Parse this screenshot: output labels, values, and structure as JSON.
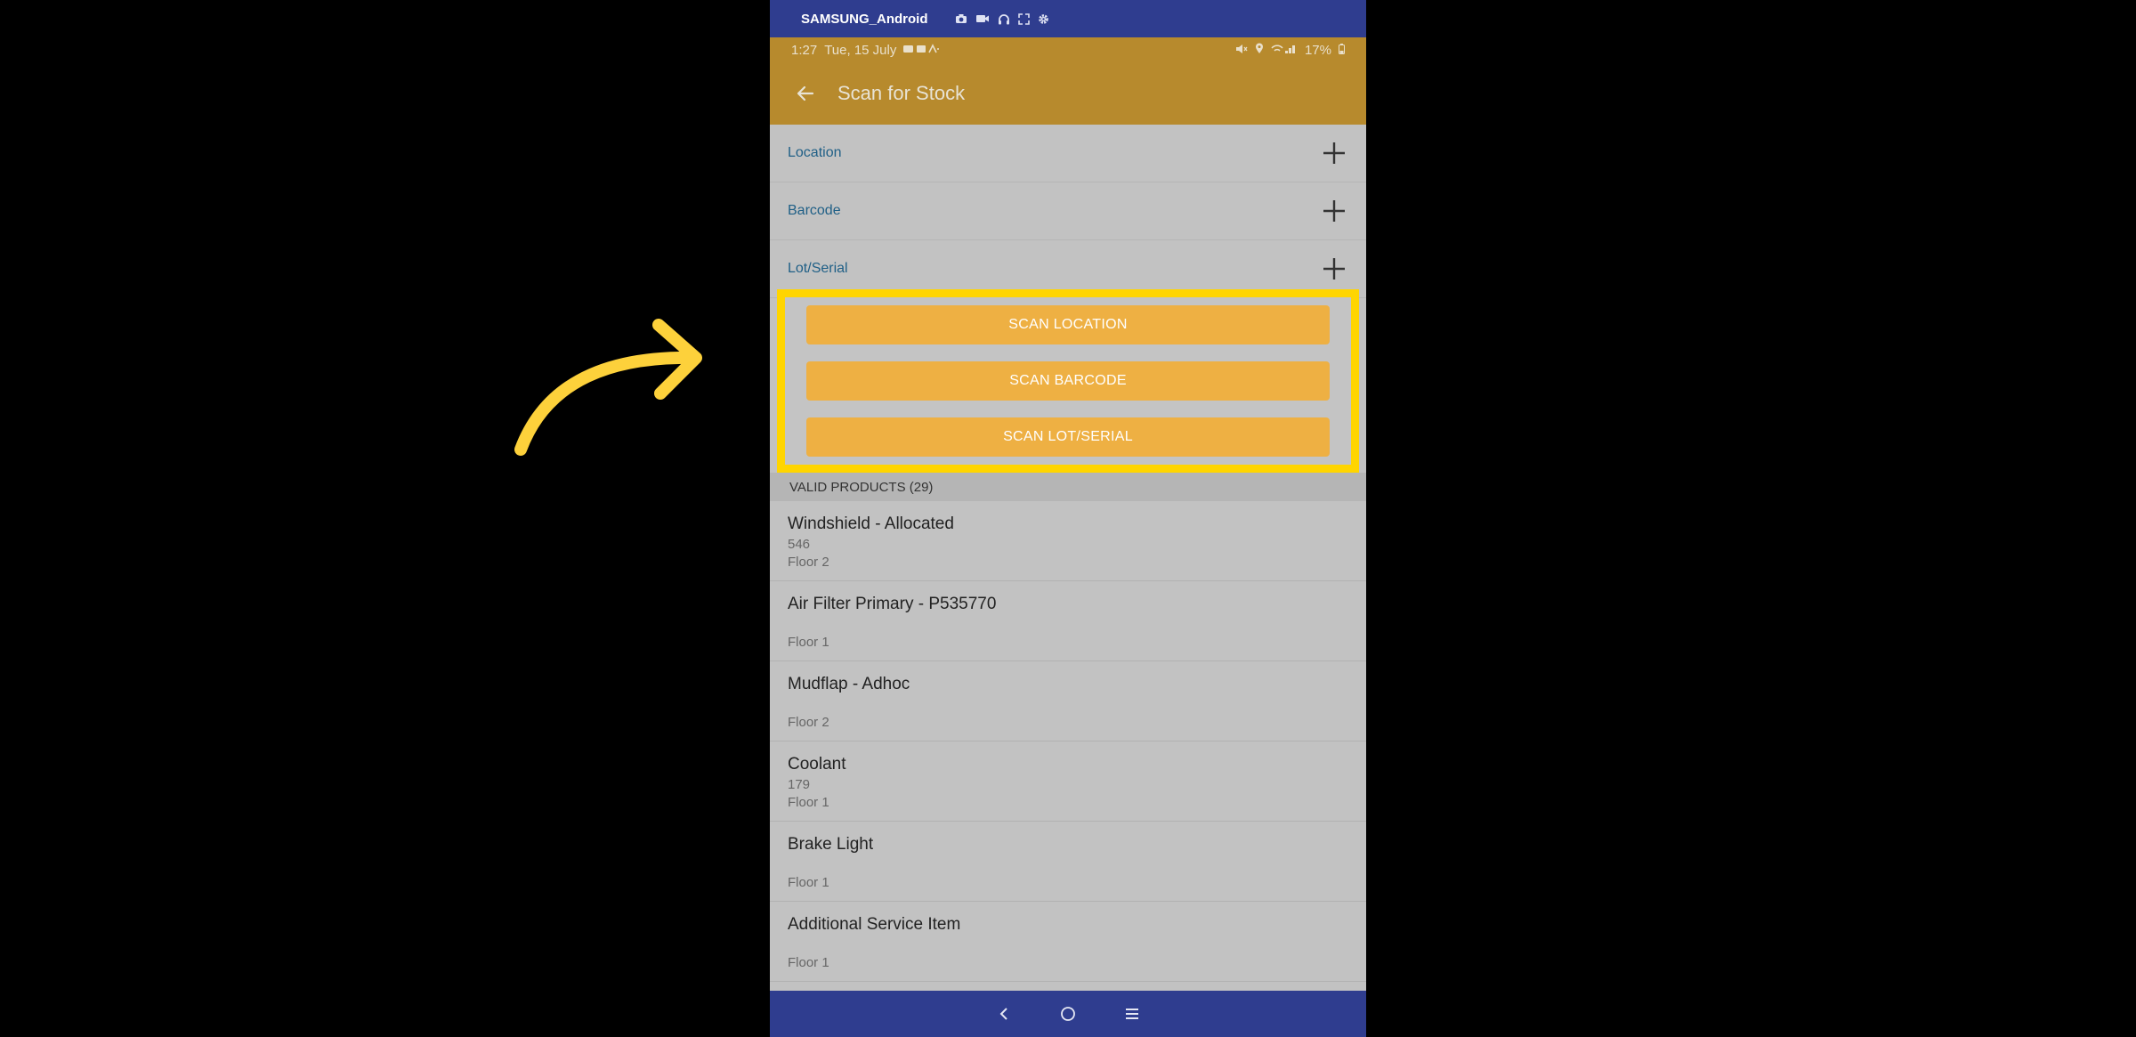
{
  "device": {
    "name": "SAMSUNG_Android",
    "icons": [
      "camera-icon",
      "video-icon",
      "headphones-icon",
      "fullscreen-icon",
      "settings-icon"
    ]
  },
  "status_bar": {
    "time": "1:27",
    "date": "Tue, 15 July",
    "battery": "17%"
  },
  "app_bar": {
    "title": "Scan for Stock"
  },
  "filters": [
    {
      "label": "Location"
    },
    {
      "label": "Barcode"
    },
    {
      "label": "Lot/Serial"
    }
  ],
  "scan_buttons": [
    {
      "label": "SCAN LOCATION"
    },
    {
      "label": "SCAN BARCODE"
    },
    {
      "label": "SCAN LOT/SERIAL"
    }
  ],
  "section": {
    "title": "VALID PRODUCTS (29)"
  },
  "products": [
    {
      "name": "Windshield - Allocated",
      "qty": "546",
      "location": "Floor 2"
    },
    {
      "name": "Air Filter Primary - P535770",
      "qty": "",
      "location": "Floor 1"
    },
    {
      "name": "Mudflap - Adhoc",
      "qty": "",
      "location": "Floor 2"
    },
    {
      "name": "Coolant",
      "qty": "179",
      "location": "Floor 1"
    },
    {
      "name": "Brake Light",
      "qty": "",
      "location": "Floor 1"
    },
    {
      "name": "Additional Service Item",
      "qty": "",
      "location": "Floor 1"
    }
  ],
  "colors": {
    "accent": "#eeb043",
    "app_bar": "#b78a2d",
    "highlight": "#ffd500",
    "device_bar": "#2f3d8f"
  }
}
